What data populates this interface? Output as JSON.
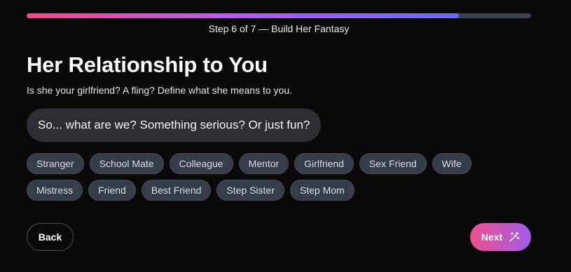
{
  "progress": {
    "step_label": "Step 6 of 7 — Build Her Fantasy",
    "fraction": 0.857,
    "colors": {
      "start": "#ec4f8c",
      "end": "#6a6cf0",
      "track": "#3a4150"
    }
  },
  "header": {
    "title": "Her Relationship to You",
    "subtitle": "Is she your girlfriend? A fling? Define what she means to you."
  },
  "prompt": {
    "text": "So... what are we? Something serious? Or just fun?"
  },
  "options": {
    "row1": [
      "Stranger",
      "School Mate",
      "Colleague",
      "Mentor",
      "Girlfriend",
      "Sex Friend",
      "Wife"
    ],
    "row2": [
      "Mistress",
      "Friend",
      "Best Friend",
      "Step Sister",
      "Step Mom"
    ]
  },
  "footer": {
    "back_label": "Back",
    "next_label": "Next",
    "next_icon": "magic-wand-icon"
  },
  "colors": {
    "background": "#0a0a0b",
    "chip_bg": "#363c4a",
    "accent_start": "#ec4f8c",
    "accent_end": "#a25ee8"
  }
}
